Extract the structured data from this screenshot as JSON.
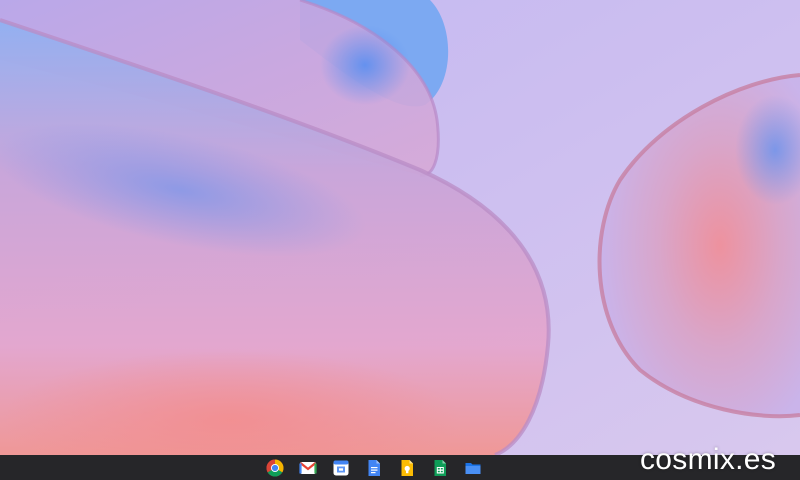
{
  "desktop": {
    "wallpaper": "chromeos-abstract-shapes",
    "colors": {
      "background": "#cbbdf0",
      "accent_blue": "#5e9bf0",
      "accent_pink": "#f28d93",
      "accent_lilac": "#d7a9d6",
      "shelf": "#262629"
    }
  },
  "shelf": {
    "apps": [
      {
        "icon": "chrome-icon"
      },
      {
        "icon": "gmail-icon"
      },
      {
        "icon": "calendar-icon"
      },
      {
        "icon": "docs-icon"
      },
      {
        "icon": "keep-icon"
      },
      {
        "icon": "sheets-icon"
      },
      {
        "icon": "files-icon"
      }
    ]
  },
  "watermark": {
    "text": "cosmix.es"
  }
}
